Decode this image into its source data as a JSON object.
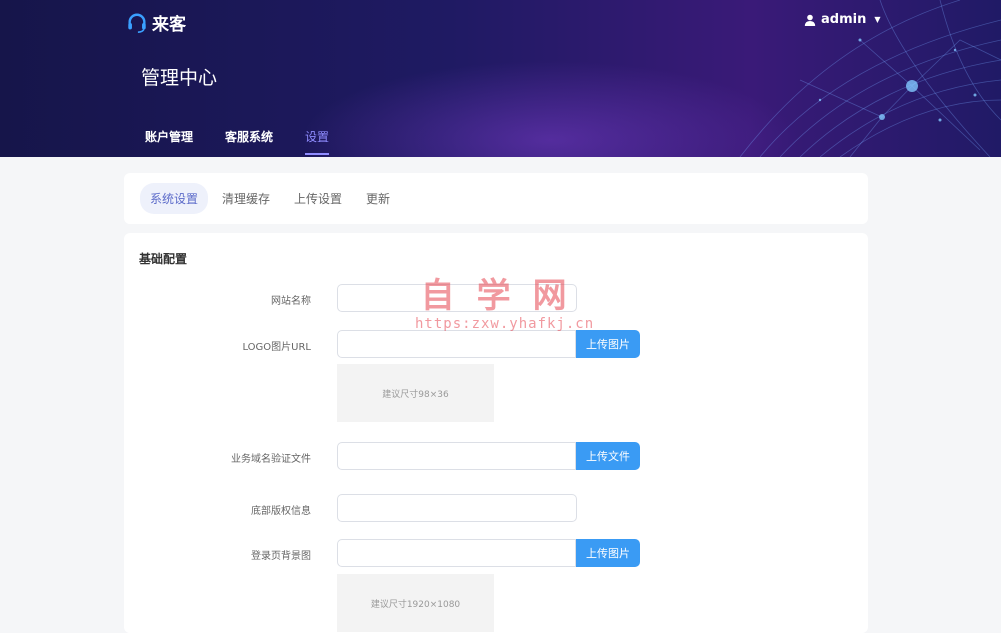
{
  "header": {
    "logo_text": "来客",
    "user_name": "admin",
    "page_title": "管理中心",
    "nav": [
      {
        "label": "账户管理",
        "active": false
      },
      {
        "label": "客服系统",
        "active": false
      },
      {
        "label": "设置",
        "active": true
      }
    ]
  },
  "subtabs": [
    {
      "label": "系统设置",
      "active": true
    },
    {
      "label": "清理缓存",
      "active": false
    },
    {
      "label": "上传设置",
      "active": false
    },
    {
      "label": "更新",
      "active": false
    }
  ],
  "form": {
    "section_title": "基础配置",
    "fields": [
      {
        "label": "网站名称",
        "value": ""
      },
      {
        "label": "LOGO图片URL",
        "value": "",
        "button": "上传图片",
        "preview": "建议尺寸98×36"
      },
      {
        "label": "业务域名验证文件",
        "value": "",
        "button": "上传文件"
      },
      {
        "label": "底部版权信息",
        "value": ""
      },
      {
        "label": "登录页背景图",
        "value": "",
        "button": "上传图片",
        "preview": "建议尺寸1920×1080"
      }
    ]
  },
  "watermark": {
    "title": "自学网",
    "url": "https:zxw.yhafkj.cn"
  },
  "colors": {
    "accent": "#3a9bf4",
    "nav_active": "#8f8cff",
    "header_bg": "#1f1a63"
  }
}
